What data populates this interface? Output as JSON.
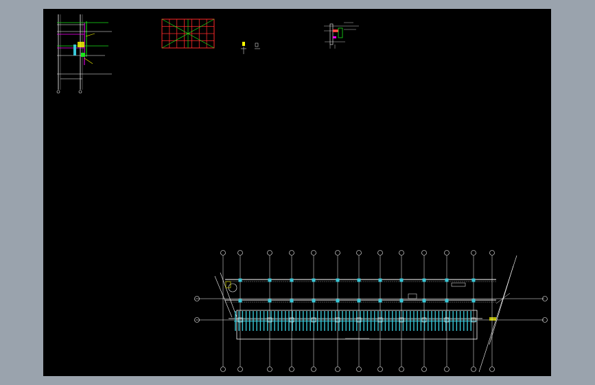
{
  "viewer": {
    "background_color": "#9aa3ad",
    "canvas_color": "#000000"
  },
  "drawing": {
    "colors": {
      "white": "#ffffff",
      "cyan": "#39c8d8",
      "red": "#ff2a2a",
      "green": "#19e619",
      "yellow": "#ffff00",
      "magenta": "#ff00ff",
      "gray": "#9a9a9a"
    },
    "icons": {
      "grid_bubble": "circle-axis-marker"
    }
  }
}
